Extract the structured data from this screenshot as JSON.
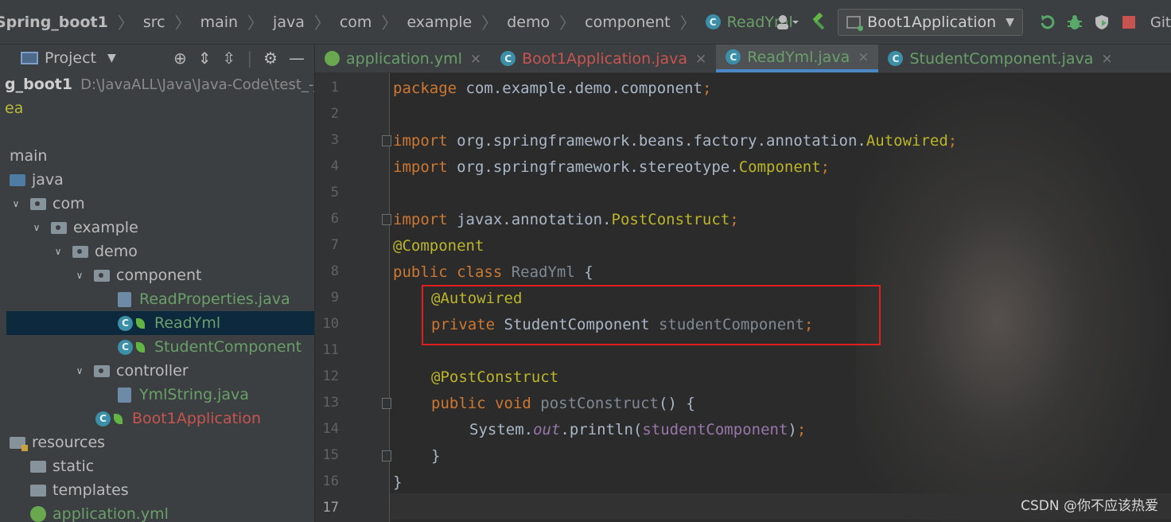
{
  "breadcrumb": [
    "Spring_boot1",
    "src",
    "main",
    "java",
    "com",
    "example",
    "demo",
    "component",
    "ReadYml"
  ],
  "toolbar": {
    "run_config": "Boot1Application",
    "git_label": "Git:"
  },
  "project_panel": {
    "title": "Project",
    "root_name": "g_boot1",
    "root_path": "D:\\JavaALL\\Java\\Java-Code\\test_-jav",
    "idea_dir": "ea",
    "tree": {
      "main": "main",
      "java": "java",
      "com": "com",
      "example": "example",
      "demo": "demo",
      "component": "component",
      "read_properties": "ReadProperties.java",
      "read_yml": "ReadYml",
      "student_component": "StudentComponent",
      "controller": "controller",
      "yml_string": "YmlString.java",
      "boot_application": "Boot1Application",
      "resources": "resources",
      "static": "static",
      "templates": "templates",
      "application_yml": "application.yml"
    }
  },
  "tabs": [
    {
      "label": "application.yml",
      "active": false
    },
    {
      "label": "Boot1Application.java",
      "active": false
    },
    {
      "label": "ReadYml.java",
      "active": true
    },
    {
      "label": "StudentComponent.java",
      "active": false
    }
  ],
  "tab_close": "×",
  "line_numbers": [
    "1",
    "2",
    "3",
    "4",
    "5",
    "6",
    "7",
    "8",
    "9",
    "10",
    "11",
    "12",
    "13",
    "14",
    "15",
    "16",
    "17"
  ],
  "code": {
    "l1": {
      "kw": "package",
      "rest": " com.example.demo.component",
      "semi": ";"
    },
    "l3": {
      "kw": "import",
      "rest": " org.springframework.beans.factory.annotation.",
      "cls": "Autowired",
      "semi": ";"
    },
    "l4": {
      "kw": "import",
      "rest": " org.springframework.stereotype.",
      "cls": "Component",
      "semi": ";"
    },
    "l6": {
      "kw": "import",
      "rest": " javax.annotation.",
      "cls": "PostConstruct",
      "semi": ";"
    },
    "l7": {
      "ann": "@Component"
    },
    "l8": {
      "kw": "public class",
      "name": " ReadYml",
      "rest": " {"
    },
    "l9": {
      "ann": "@Autowired"
    },
    "l10": {
      "kw": "private",
      "type": " StudentComponent",
      "field": " studentComponent",
      "semi": ";"
    },
    "l12": {
      "ann": "@PostConstruct"
    },
    "l13": {
      "kw": "public void",
      "name": " postConstruct",
      "rest": "() {"
    },
    "l14": {
      "pre": "System.",
      "out": "out",
      "mid": ".println(",
      "field": "studentComponent",
      "post": ")",
      "semi": ";"
    },
    "l15": {
      "text": "}"
    },
    "l16": {
      "text": "}"
    }
  },
  "watermark": "CSDN @你不应该热爱"
}
